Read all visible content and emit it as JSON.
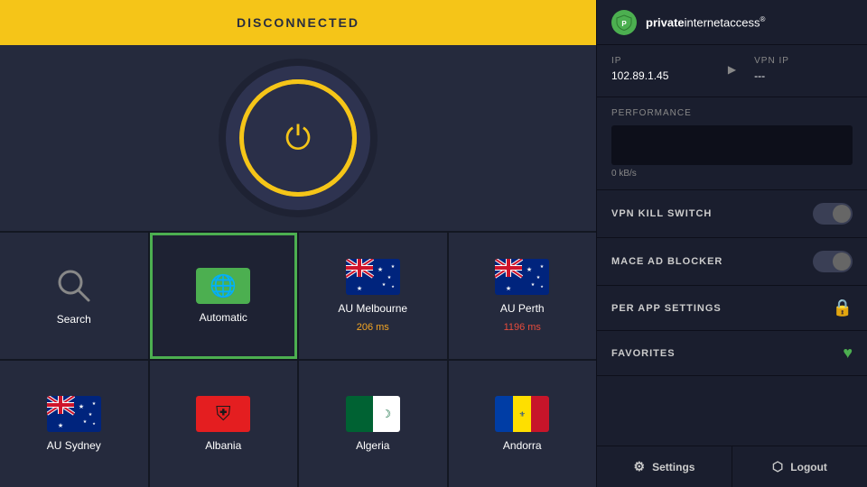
{
  "header": {
    "status": "DISCONNECTED",
    "brand": {
      "name_bold": "private",
      "name_regular": "internetaccess",
      "sup": "®"
    }
  },
  "ip_section": {
    "ip_label": "IP",
    "ip_value": "102.89.1.45",
    "vpn_ip_label": "VPN IP",
    "vpn_ip_value": "---"
  },
  "performance": {
    "label": "PERFORMANCE",
    "value": "0 kB/s"
  },
  "toggles": {
    "kill_switch": {
      "label": "VPN KILL SWITCH",
      "enabled": false
    },
    "mace": {
      "label": "MACE AD BLOCKER",
      "enabled": false
    }
  },
  "per_app": {
    "label": "PER APP SETTINGS"
  },
  "favorites": {
    "label": "FAVORITES"
  },
  "buttons": {
    "settings": "Settings",
    "logout": "Logout"
  },
  "grid": {
    "cells": [
      {
        "id": "search",
        "label": "Search",
        "type": "search"
      },
      {
        "id": "automatic",
        "label": "Automatic",
        "type": "auto",
        "selected": true
      },
      {
        "id": "au-melbourne",
        "label": "AU Melbourne",
        "sublabel": "206 ms",
        "sublabel_color": "orange",
        "type": "flag",
        "country": "au"
      },
      {
        "id": "au-perth",
        "label": "AU Perth",
        "sublabel": "1196 ms",
        "sublabel_color": "red",
        "type": "flag",
        "country": "au"
      },
      {
        "id": "au-sydney",
        "label": "AU Sydney",
        "type": "flag",
        "country": "au"
      },
      {
        "id": "albania",
        "label": "Albania",
        "type": "flag",
        "country": "al"
      },
      {
        "id": "algeria",
        "label": "Algeria",
        "type": "flag",
        "country": "dz"
      },
      {
        "id": "andorra",
        "label": "Andorra",
        "type": "flag",
        "country": "ad"
      }
    ]
  }
}
